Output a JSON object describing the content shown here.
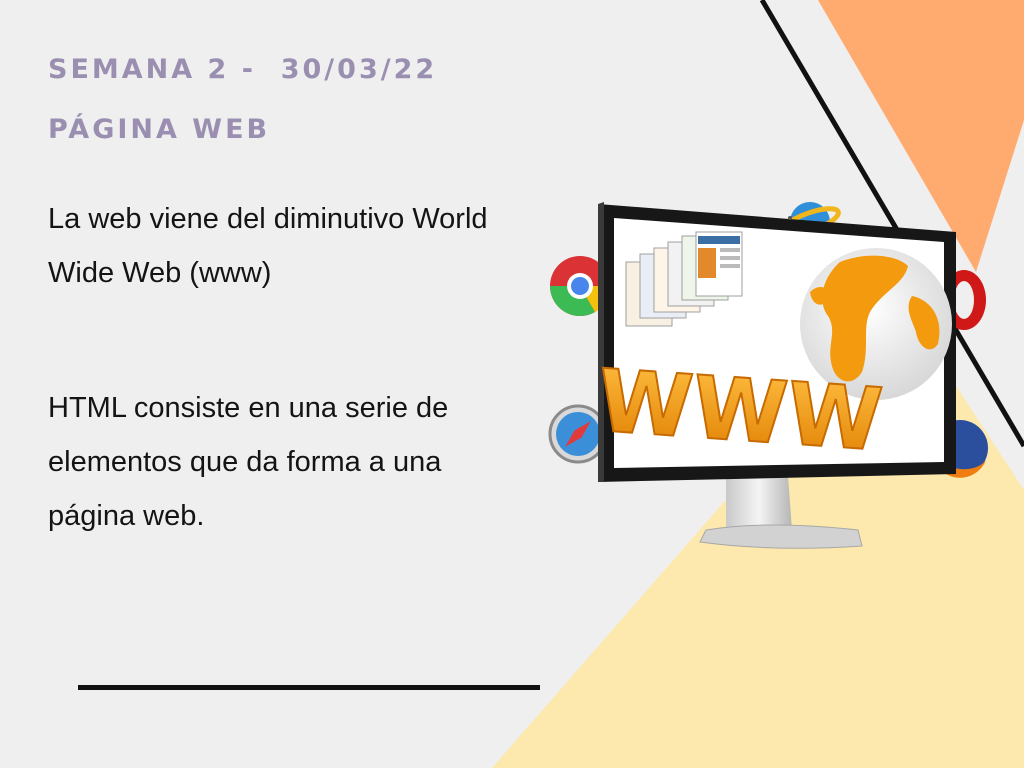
{
  "slide": {
    "heading_week": "SEMANA 2 -  30/03/22",
    "heading_topic": "PÁGINA WEB",
    "paragraph_1": "La web viene del diminutivo World Wide Web (www)",
    "paragraph_2": "HTML consiste en una serie de elementos que da forma a una página web."
  },
  "illustration": {
    "monitor_caption": "WWW",
    "icons": [
      "chrome-icon",
      "safari-icon",
      "firefox-icon",
      "globe-icon",
      "opera-icon",
      "ie-icon"
    ]
  },
  "colors": {
    "background": "#efefef",
    "heading": "#9a8fb0",
    "text": "#141414",
    "peach_triangle": "#ffaa6f",
    "yellow_triangle": "#fde9ad",
    "accent_orange": "#f39a0f"
  }
}
